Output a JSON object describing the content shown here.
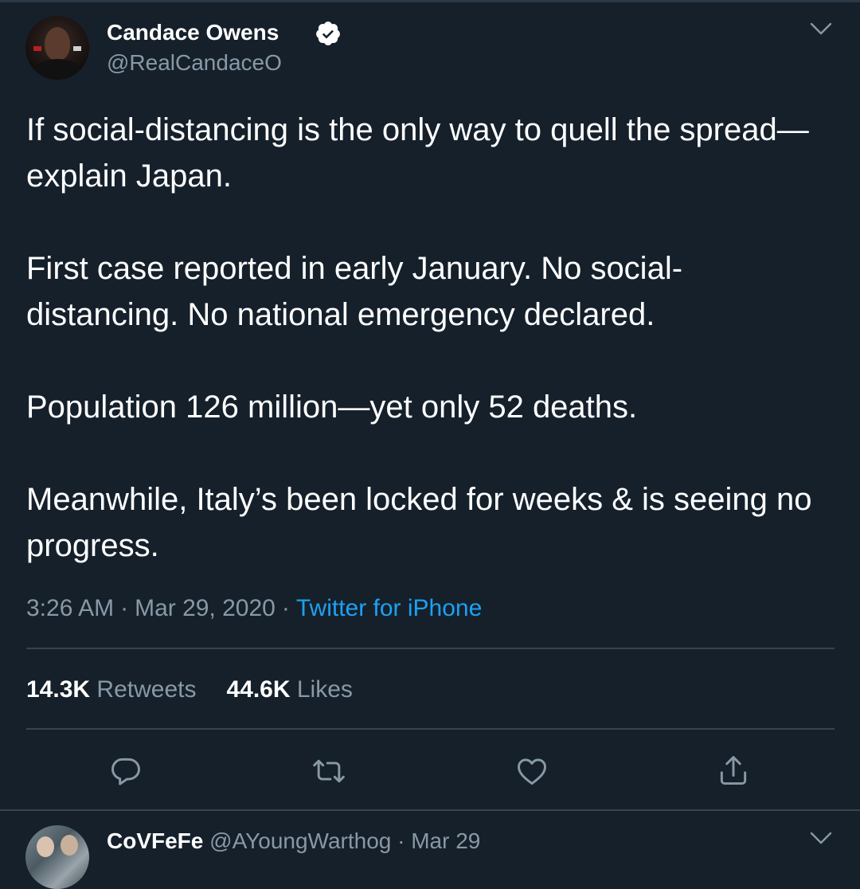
{
  "tweet": {
    "author_name": "Candace Owens",
    "author_handle": "@RealCandaceO",
    "verified": true,
    "paragraphs": [
      "If social-distancing is the only way to quell the spread—explain Japan.",
      "First case reported in early January. No social-distancing. No national emergency declared.",
      "Population 126 million—yet only 52 deaths.",
      "Meanwhile, Italy’s been locked for weeks & is seeing no progress."
    ],
    "time": "3:26 AM",
    "date": "Mar 29, 2020",
    "source": "Twitter for iPhone",
    "meta_separator": "·",
    "retweets_count": "14.3K",
    "retweets_label": "Retweets",
    "likes_count": "44.6K",
    "likes_label": "Likes"
  },
  "actions": [
    {
      "name": "reply-icon"
    },
    {
      "name": "retweet-icon"
    },
    {
      "name": "like-icon"
    },
    {
      "name": "share-icon"
    }
  ],
  "reply": {
    "author_name": "CoVFeFe",
    "author_handle": "@AYoungWarthog",
    "separator": "·",
    "date": "Mar 29"
  },
  "colors": {
    "background": "#15202b",
    "text_primary": "#ffffff",
    "text_secondary": "#8899a6",
    "accent": "#1da1f2",
    "divider": "#38444d"
  },
  "icons": {
    "verified": "verified-badge-icon",
    "caret": "chevron-down-icon"
  }
}
